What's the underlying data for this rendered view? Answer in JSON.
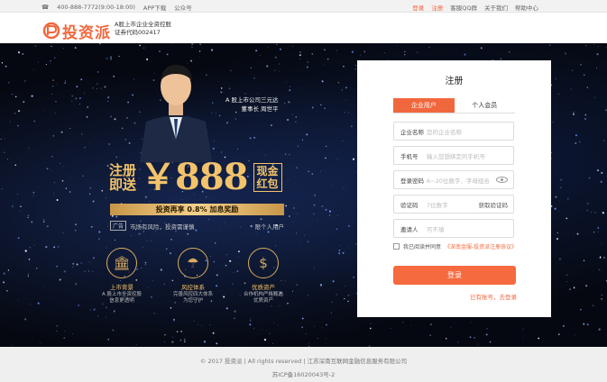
{
  "topbar": {
    "phone": "400-888-7772(9:00-18:00)",
    "app_download": "APP下载",
    "official_account": "公众号",
    "login": "登录",
    "register": "注册",
    "qq_group": "客服QQ群",
    "about": "关于我们",
    "help": "帮助中心"
  },
  "header": {
    "logo_text": "投资派",
    "sub1": "A股上市企业全资控股",
    "sub2": "证券代码002417"
  },
  "hero": {
    "quote1": "A 股上市公司三元达",
    "quote2": "董事长 周世平",
    "zhuce": "注册",
    "jisong": "即送",
    "amount": "￥888",
    "box1": "现金",
    "box2": "红包",
    "bar": "投资再享 0.8% 加息奖励",
    "ad_tag": "广告",
    "ad_text": "市场有风险，投资需谨慎",
    "ad_note": "* 限个人用户",
    "features": [
      {
        "icon": "bank-icon",
        "glyph": "🏛",
        "title": "上市背景",
        "desc1": "A 股上市全资控股",
        "desc2": "信息更透明"
      },
      {
        "icon": "umbrella-icon",
        "glyph": "☂",
        "title": "风控体系",
        "desc1": "完善风控四大体系",
        "desc2": "为您守护"
      },
      {
        "icon": "money-hand-icon",
        "glyph": "$",
        "title": "优质资产",
        "desc1": "合作机构严格甄选",
        "desc2": "优质资产"
      }
    ]
  },
  "panel": {
    "title": "注册",
    "tab_company": "企业用户",
    "tab_person": "个人会员",
    "company_label": "企业名称",
    "company_ph": "您的企业名称",
    "phone_label": "手机号",
    "phone_ph": "输入您想绑定的手机号",
    "pwd_label": "登录密码",
    "pwd_ph": "6~20位数字、字母组合",
    "code_label": "验证码",
    "code_ph": "7位数字",
    "get_code": "获取验证码",
    "inviter_label": "邀请人",
    "inviter_ph": "可不填",
    "agree_text": "我已阅读并同意",
    "agree_link": "《深南金服-投资派注册协议》",
    "submit": "登录",
    "login_link": "已有账号，去登录"
  },
  "footer": {
    "line1": "© 2017 投资派 | All rights reserved | 江苏深南互联网金融信息服务有限公司",
    "line2": "苏ICP备16020043号-2"
  }
}
